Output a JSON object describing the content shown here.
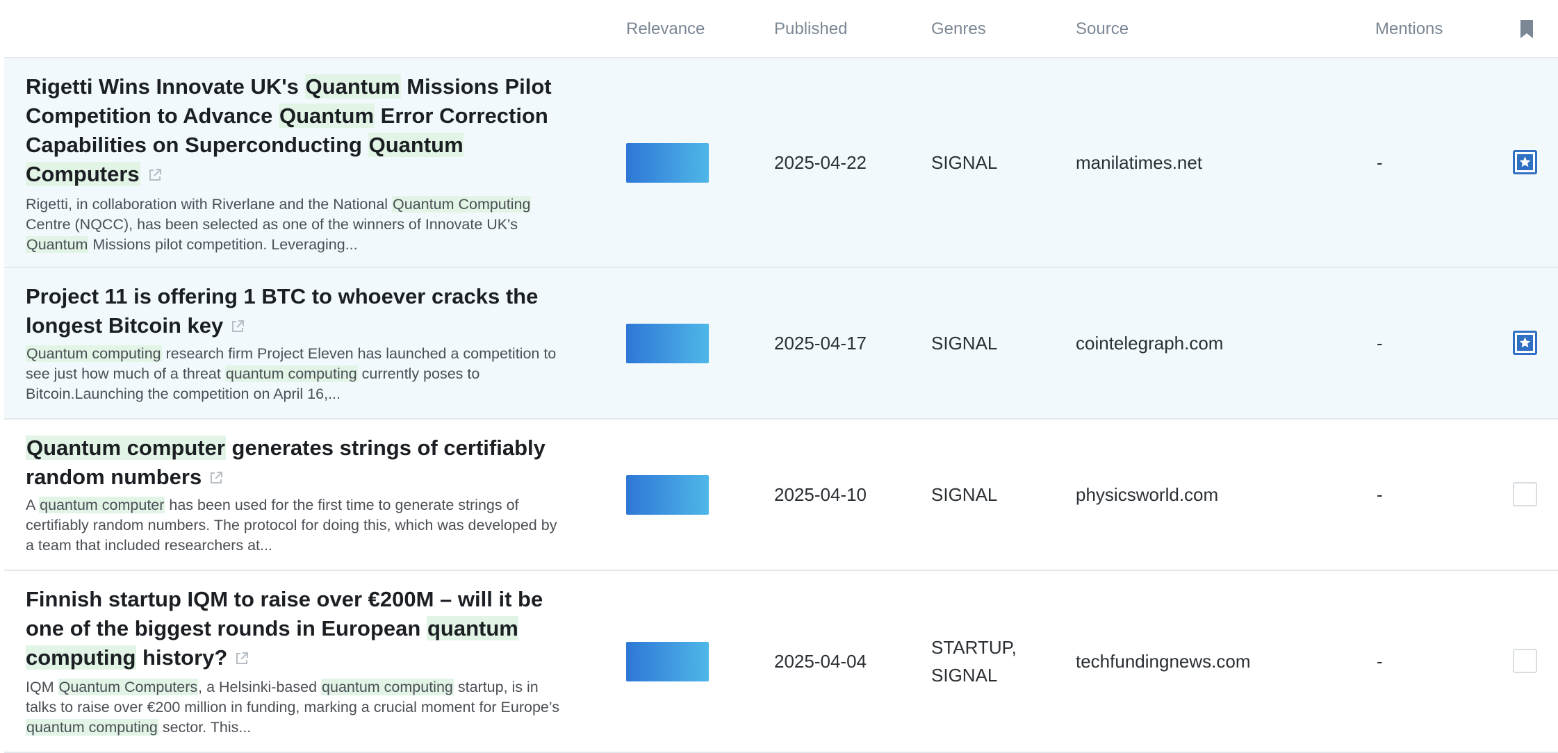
{
  "header": {
    "relevance": "Relevance",
    "published": "Published",
    "genres": "Genres",
    "source": "Source",
    "mentions": "Mentions",
    "bookmark_icon": "bookmark-icon"
  },
  "rows": [
    {
      "title_parts": [
        {
          "t": "Rigetti Wins Innovate UK's "
        },
        {
          "t": "Quantum",
          "h": true
        },
        {
          "t": " Missions Pilot Competition to Advance "
        },
        {
          "t": "Quantum",
          "h": true
        },
        {
          "t": " Error Correction Capabilities on Superconducting "
        },
        {
          "t": "Quantum Computers",
          "h": true
        }
      ],
      "snippet_parts": [
        {
          "t": "Rigetti, in collaboration with Riverlane and the National "
        },
        {
          "t": "Quantum Computing",
          "h": true
        },
        {
          "t": " Centre (NQCC), has been selected as one of the winners of Innovate UK's "
        },
        {
          "t": "Quantum",
          "h": true
        },
        {
          "t": " Missions pilot competition. Leveraging..."
        }
      ],
      "relevance": 1.0,
      "published": "2025-04-22",
      "genres": "SIGNAL",
      "source": "manilatimes.net",
      "mentions": "-",
      "bookmarked": true
    },
    {
      "title_parts": [
        {
          "t": "Project 11 is offering 1 BTC to whoever cracks the longest Bitcoin key"
        }
      ],
      "snippet_parts": [
        {
          "t": "Quantum computing",
          "h": true
        },
        {
          "t": " research firm Project Eleven has launched a competition to see just how much of a threat "
        },
        {
          "t": "quantum computing",
          "h": true
        },
        {
          "t": " currently poses to Bitcoin.Launching the competition on April 16,..."
        }
      ],
      "relevance": 1.0,
      "published": "2025-04-17",
      "genres": "SIGNAL",
      "source": "cointelegraph.com",
      "mentions": "-",
      "bookmarked": true
    },
    {
      "title_parts": [
        {
          "t": "Quantum computer",
          "h": true
        },
        {
          "t": " generates strings of certifiably random numbers"
        }
      ],
      "snippet_parts": [
        {
          "t": "A "
        },
        {
          "t": "quantum computer",
          "h": true
        },
        {
          "t": " has been used for the first time to generate strings of certifiably random numbers. The protocol for doing this, which was developed by a team that included researchers at..."
        }
      ],
      "relevance": 1.0,
      "published": "2025-04-10",
      "genres": "SIGNAL",
      "source": "physicsworld.com",
      "mentions": "-",
      "bookmarked": false
    },
    {
      "title_parts": [
        {
          "t": "Finnish startup IQM to raise over €200M – will it be one of the biggest rounds in European "
        },
        {
          "t": "quantum computing",
          "h": true
        },
        {
          "t": " history?"
        }
      ],
      "snippet_parts": [
        {
          "t": "IQM "
        },
        {
          "t": "Quantum Computers",
          "h": true
        },
        {
          "t": ", a Helsinki-based "
        },
        {
          "t": "quantum computing",
          "h": true
        },
        {
          "t": " startup, is in talks to raise over €200 million in funding, marking a crucial moment for Europe’s "
        },
        {
          "t": "quantum computing",
          "h": true
        },
        {
          "t": " sector. This..."
        }
      ],
      "relevance": 1.0,
      "published": "2025-04-04",
      "genres": "STARTUP, SIGNAL",
      "source": "techfundingnews.com",
      "mentions": "-",
      "bookmarked": false
    }
  ],
  "colors": {
    "highlight": "#e2f4e6",
    "selected_row": "#f1f9fd",
    "relevance_start": "#2e77d6",
    "relevance_end": "#4fb7e8",
    "checkbox_accent": "#2f6fc4"
  }
}
